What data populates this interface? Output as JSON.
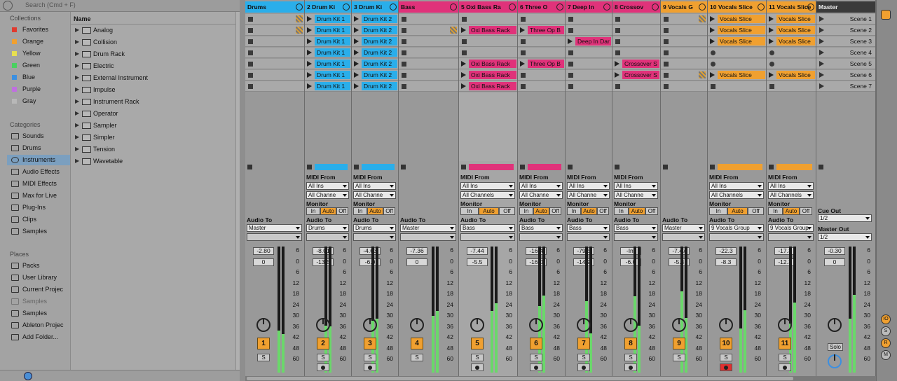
{
  "search": {
    "placeholder": "Search (Cmd + F)"
  },
  "collections": {
    "header": "Collections",
    "items": [
      {
        "label": "Favorites",
        "color": "#e03a2f"
      },
      {
        "label": "Orange",
        "color": "#f0a030"
      },
      {
        "label": "Yellow",
        "color": "#e8e050"
      },
      {
        "label": "Green",
        "color": "#4ad060"
      },
      {
        "label": "Blue",
        "color": "#3c8fe0"
      },
      {
        "label": "Purple",
        "color": "#c070e0"
      },
      {
        "label": "Gray",
        "color": "#b8b8b8"
      }
    ]
  },
  "categories": {
    "header": "Categories",
    "items": [
      "Sounds",
      "Drums",
      "Instruments",
      "Audio Effects",
      "MIDI Effects",
      "Max for Live",
      "Plug-Ins",
      "Clips",
      "Samples"
    ],
    "selected": "Instruments"
  },
  "places": {
    "header": "Places",
    "items": [
      "Packs",
      "User Library",
      "Current Projec",
      "Samples",
      "Samples",
      "Ableton Projec",
      "Add Folder..."
    ]
  },
  "filelist": {
    "header": "Name",
    "items": [
      "Analog",
      "Collision",
      "Drum Rack",
      "Electric",
      "External Instrument",
      "Impulse",
      "Instrument Rack",
      "Operator",
      "Sampler",
      "Simpler",
      "Tension",
      "Wavetable"
    ]
  },
  "tracks": [
    {
      "name": "Drums",
      "color": "#2aaeea",
      "num": "1",
      "audio_to": "Master",
      "vol": "-2.80",
      "pan": "0"
    },
    {
      "name": "2 Drum Ki",
      "color": "#2aaeea",
      "num": "2",
      "midi_from": "All Ins",
      "channel": "All Channe",
      "audio_to": "Drums",
      "vol": "-8.01",
      "pan": "-13.5"
    },
    {
      "name": "3 Drum Ki",
      "color": "#2aaeea",
      "num": "3",
      "midi_from": "All Ins",
      "channel": "All Channe",
      "audio_to": "Drums",
      "vol": "-4.63",
      "pan": "-6.0"
    },
    {
      "name": "Bass",
      "color": "#e0327a",
      "num": "4",
      "audio_to": "Master",
      "vol": "-7.36",
      "pan": "0"
    },
    {
      "name": "5 Oxi Bass Ra",
      "color": "#e0327a",
      "num": "5",
      "midi_from": "All Ins",
      "channel": "All Channels",
      "audio_to": "Bass",
      "vol": "-7.44",
      "pan": "-5.5"
    },
    {
      "name": "6 Three O",
      "color": "#e0327a",
      "num": "6",
      "midi_from": "All Ins",
      "channel": "All Channe",
      "audio_to": "Bass",
      "vol": "-16.4",
      "pan": "-16.0"
    },
    {
      "name": "7 Deep In",
      "color": "#e0327a",
      "num": "7",
      "midi_from": "All Ins",
      "channel": "All Channe",
      "audio_to": "Bass",
      "vol": "-79.5",
      "pan": "-14.9"
    },
    {
      "name": "8 Crossov",
      "color": "#e0327a",
      "num": "8",
      "midi_from": "All Ins",
      "channel": "All Channe",
      "audio_to": "Bass",
      "vol": "-Inf",
      "pan": "-6.0"
    },
    {
      "name": "9 Vocals G",
      "color": "#f0a030",
      "num": "9",
      "audio_to": "Master",
      "vol": "-7.47",
      "pan": "-5.4"
    },
    {
      "name": "10 Vocals Slice",
      "color": "#f0a030",
      "num": "10",
      "midi_from": "All Ins",
      "channel": "All Channels",
      "audio_to": "9 Vocals Group",
      "vol": "-22.3",
      "pan": "-8.3"
    },
    {
      "name": "11 Vocals Slice",
      "color": "#f0a030",
      "num": "11",
      "midi_from": "All Ins",
      "channel": "All Channels",
      "audio_to": "9 Vocals Group",
      "vol": "-17.3",
      "pan": "-12.3"
    },
    {
      "name": "Master",
      "color": "#3a3a3a",
      "vol": "-0.30",
      "pan": "0"
    }
  ],
  "clips": {
    "drumkit1": "Drum Kit 1",
    "drumkit2": "Drum Kit 2",
    "oxi": "Oxi Bass Rack",
    "three": "Three Op B",
    "deep": "Deep In Dar",
    "cross": "Crossover S",
    "vocals": "Vocals Slice"
  },
  "scenes": [
    "Scene 1",
    "Scene 2",
    "Scene 3",
    "Scene 4",
    "Scene 5",
    "Scene 6",
    "Scene 7"
  ],
  "labels": {
    "midi_from": "MIDI From",
    "monitor": "Monitor",
    "audio_to": "Audio To",
    "mon_in": "In",
    "mon_auto": "Auto",
    "mon_off": "Off",
    "solo": "S",
    "cue_out": "Cue Out",
    "cue_val": "1/2",
    "master_out": "Master Out",
    "master_val": "1/2",
    "solo_master": "Solo"
  },
  "meter_ticks": [
    "6",
    "0",
    "6",
    "12",
    "18",
    "24",
    "30",
    "36",
    "42",
    "48",
    "60"
  ],
  "right_strip": {
    "btn1": "IO",
    "btn2": "S",
    "btn3": "R",
    "btn4": "M"
  }
}
